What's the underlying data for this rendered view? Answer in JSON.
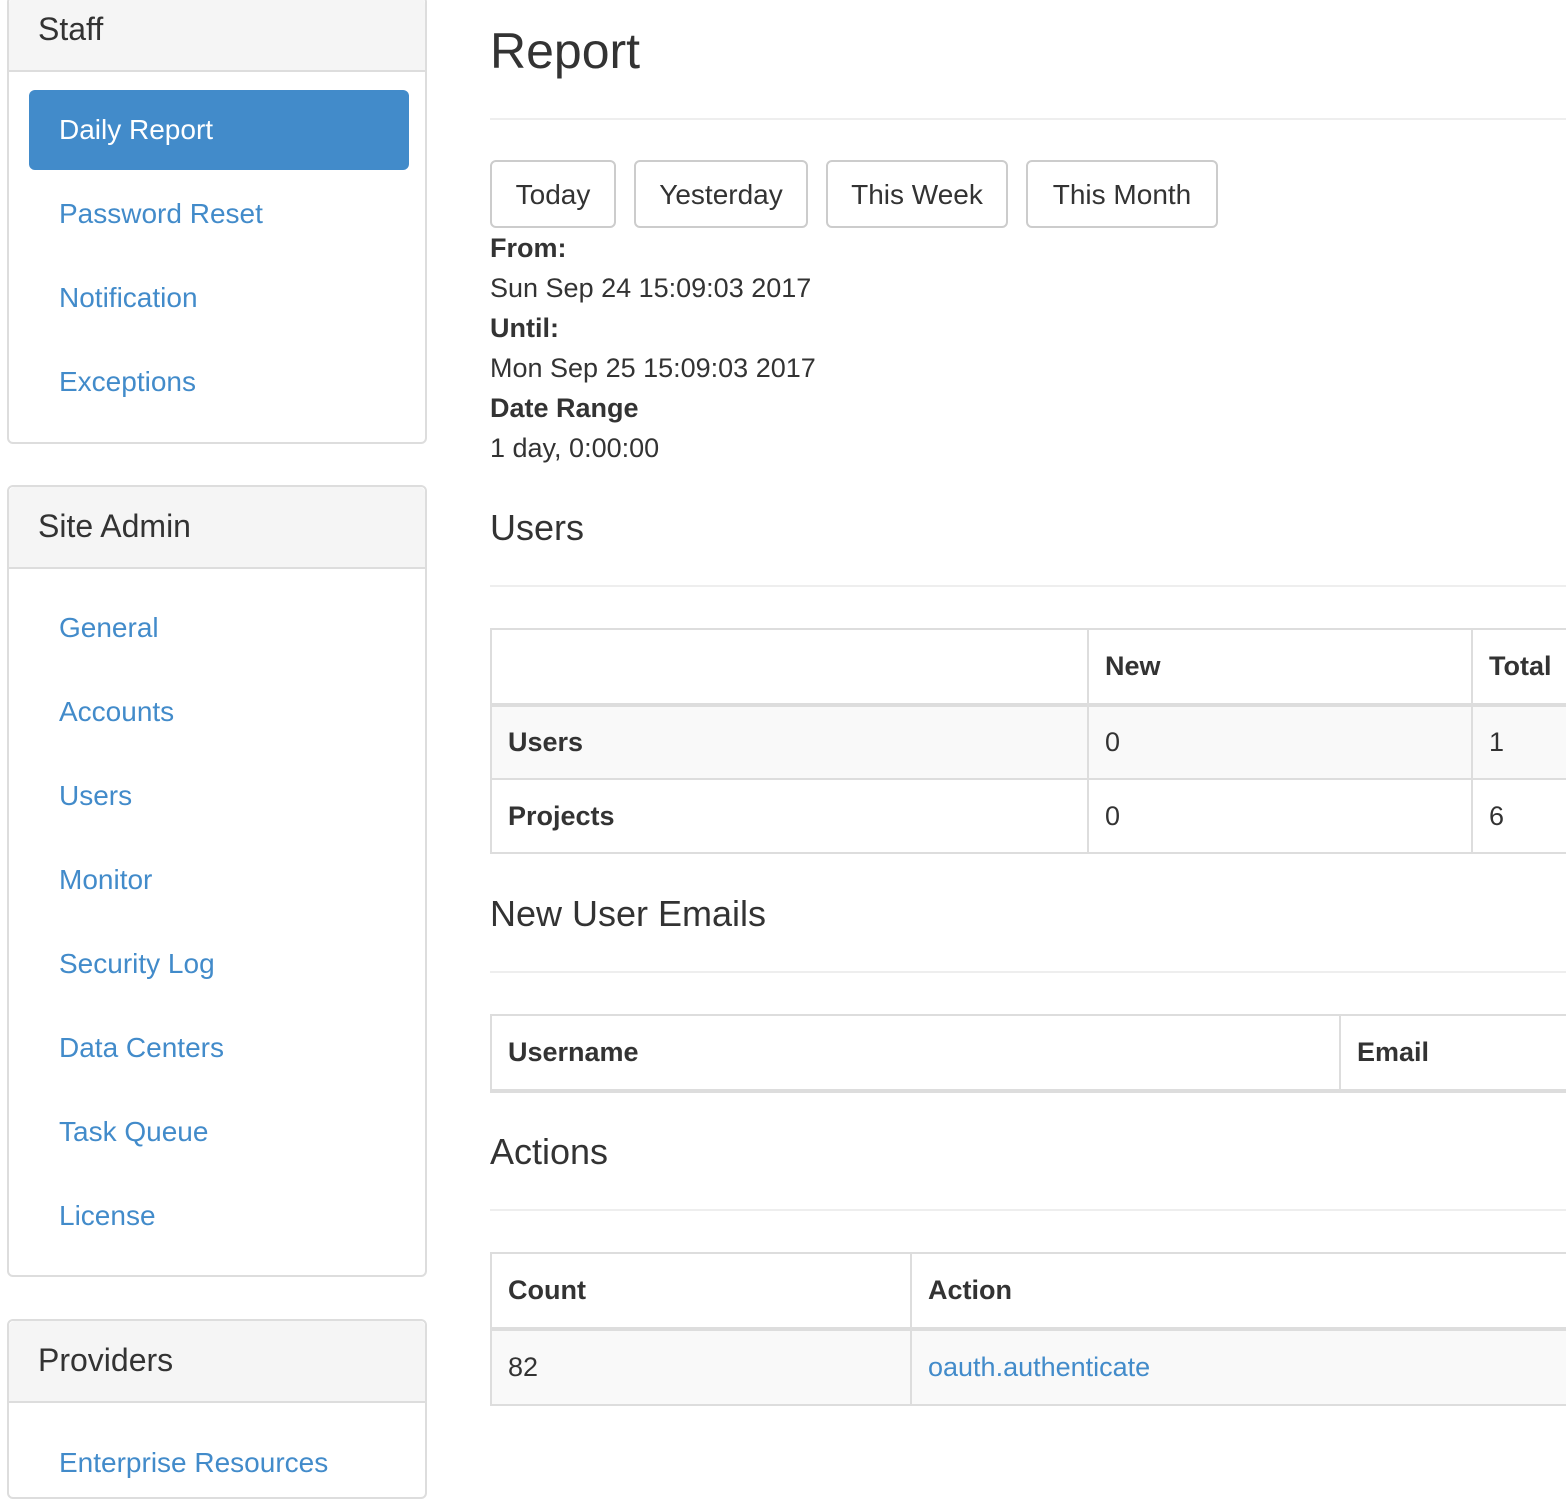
{
  "sidebar": {
    "staff": {
      "title": "Staff",
      "items": [
        {
          "label": "Daily Report"
        },
        {
          "label": "Password Reset"
        },
        {
          "label": "Notification"
        },
        {
          "label": "Exceptions"
        }
      ]
    },
    "site_admin": {
      "title": "Site Admin",
      "items": [
        {
          "label": "General"
        },
        {
          "label": "Accounts"
        },
        {
          "label": "Users"
        },
        {
          "label": "Monitor"
        },
        {
          "label": "Security Log"
        },
        {
          "label": "Data Centers"
        },
        {
          "label": "Task Queue"
        },
        {
          "label": "License"
        }
      ]
    },
    "providers": {
      "title": "Providers",
      "items": [
        {
          "label": "Enterprise Resources"
        }
      ]
    }
  },
  "main": {
    "title": "Report",
    "range_buttons": [
      "Today",
      "Yesterday",
      "This Week",
      "This Month"
    ],
    "from_label": "From:",
    "from_value": "Sun Sep 24 15:09:03 2017",
    "until_label": "Until:",
    "until_value": "Mon Sep 25 15:09:03 2017",
    "range_label": "Date Range",
    "range_value": "1 day, 0:00:00",
    "users_section": {
      "title": "Users",
      "headers": [
        "",
        "New",
        "Total"
      ],
      "rows": [
        {
          "label": "Users",
          "new": "0",
          "total": "1"
        },
        {
          "label": "Projects",
          "new": "0",
          "total": "6"
        }
      ]
    },
    "emails_section": {
      "title": "New User Emails",
      "headers": [
        "Username",
        "Email"
      ]
    },
    "actions_section": {
      "title": "Actions",
      "headers": [
        "Count",
        "Action"
      ],
      "rows": [
        {
          "count": "82",
          "action": "oauth.authenticate"
        }
      ]
    }
  },
  "colors": {
    "accent": "#428bca",
    "border": "#dddddd",
    "panel_heading_bg": "#f5f5f5"
  }
}
